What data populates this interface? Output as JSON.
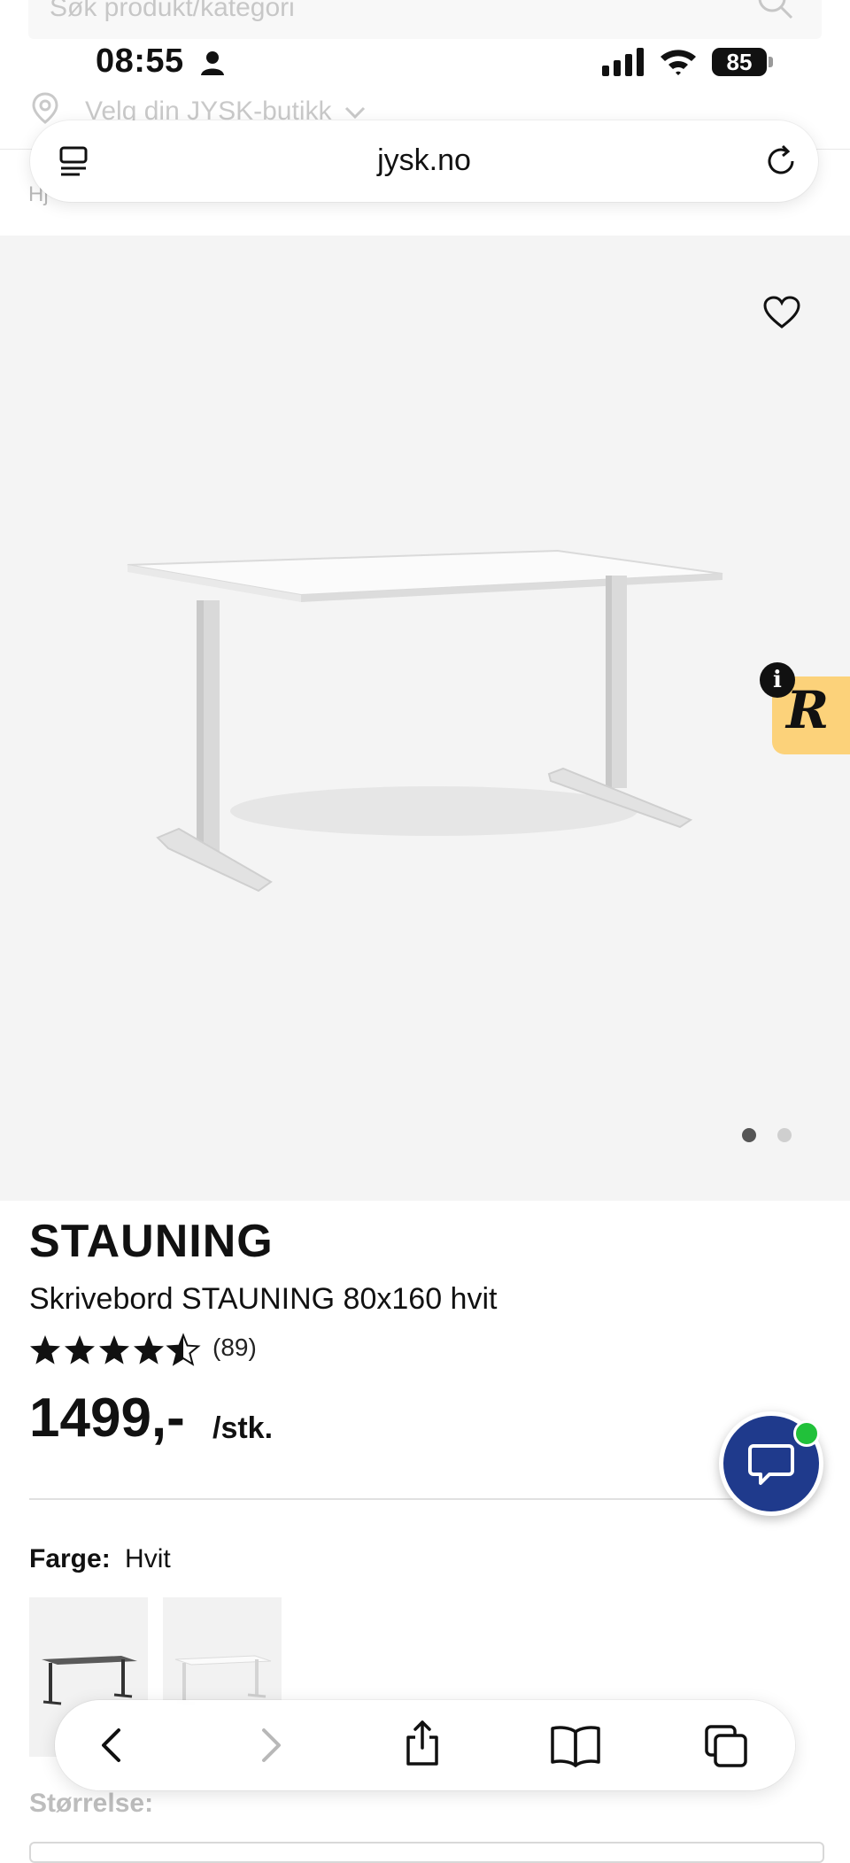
{
  "site": {
    "search_placeholder": "Søk produkt/kategori",
    "store_selector": "Velg din JYSK-butikk",
    "breadcrumb_fragment": "Hj"
  },
  "status_bar": {
    "time": "08:55",
    "battery": "85"
  },
  "browser": {
    "url": "jysk.no"
  },
  "gallery": {
    "image_count": 2,
    "active_index": 1
  },
  "widget": {
    "letter": "R",
    "info": "i"
  },
  "product": {
    "brand": "STAUNING",
    "title": "Skrivebord STAUNING 80x160 hvit",
    "rating": 4.5,
    "review_count": "(89)",
    "price": "1499,-",
    "unit": "/stk.",
    "color_label": "Farge:",
    "color_value": "Hvit",
    "size_label": "Størrelse:"
  },
  "colors": {
    "chat_button": "#1f3a8c",
    "online": "#21c13a",
    "widget_bg": "#fcd27a",
    "gallery_bg": "#f4f4f4"
  }
}
